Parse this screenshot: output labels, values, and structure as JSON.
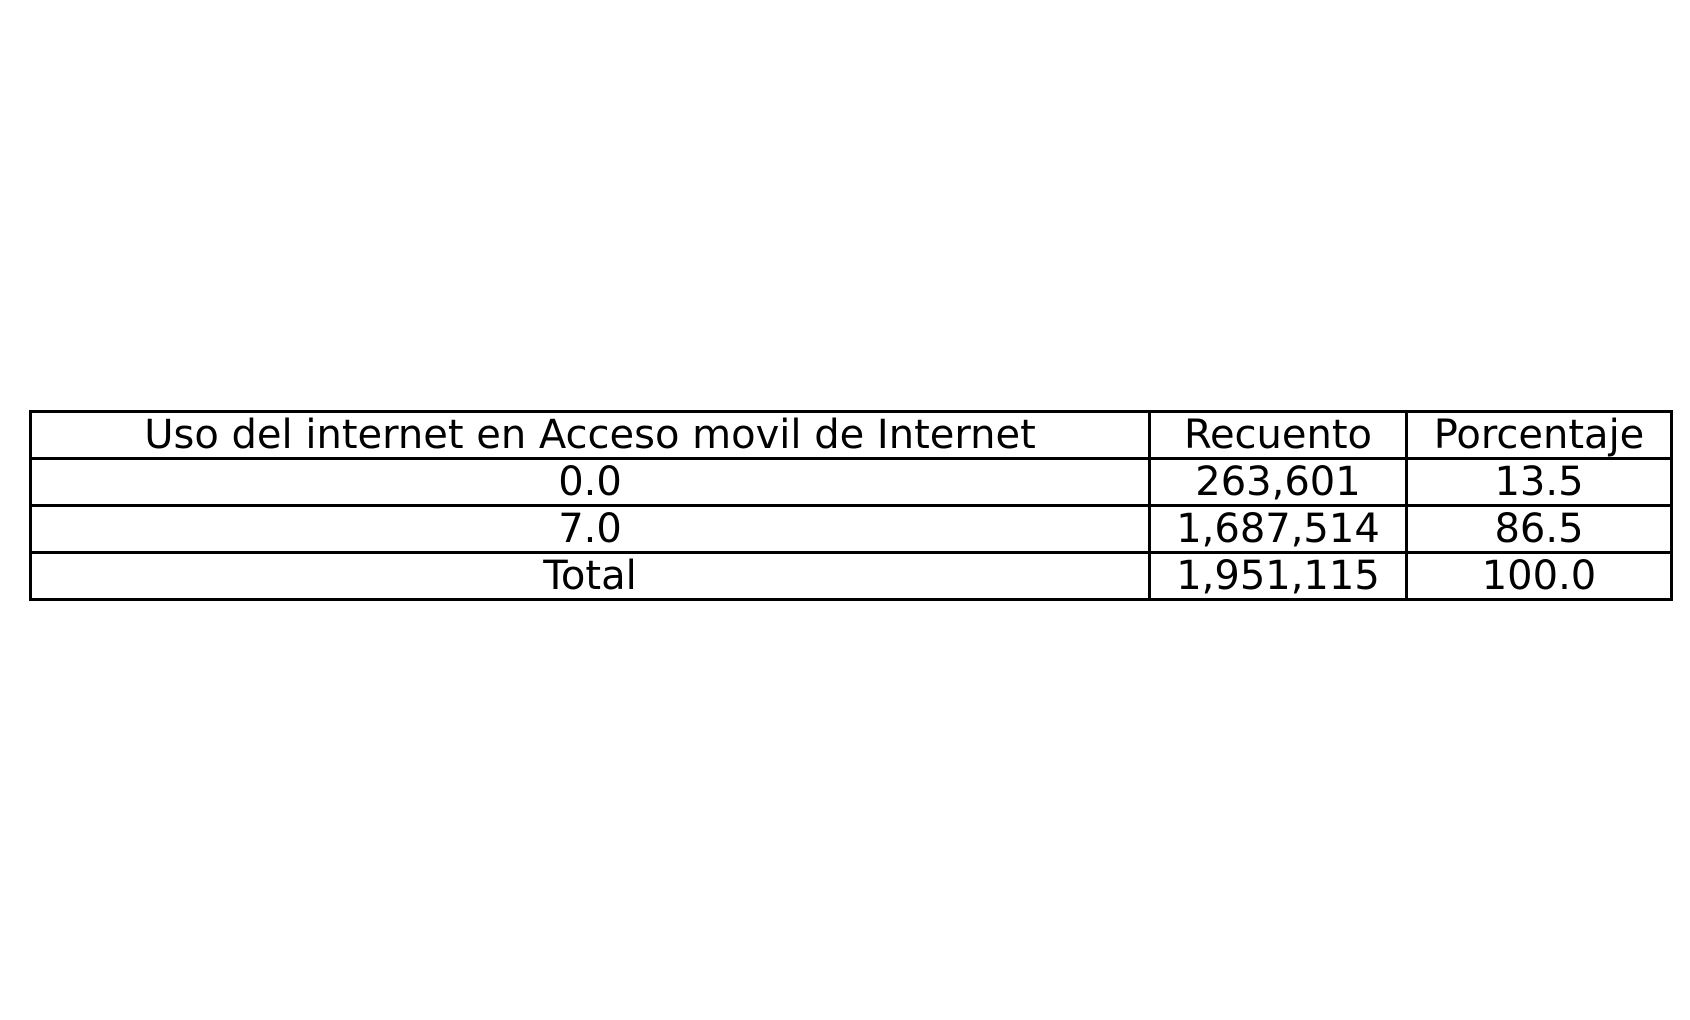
{
  "chart_data": {
    "type": "table",
    "columns": [
      "Uso del internet en Acceso movil de Internet",
      "Recuento",
      "Porcentaje"
    ],
    "rows": [
      [
        "0.0",
        "263,601",
        "13.5"
      ],
      [
        "7.0",
        "1,687,514",
        "86.5"
      ],
      [
        "Total",
        "1,951,115",
        "100.0"
      ]
    ]
  }
}
